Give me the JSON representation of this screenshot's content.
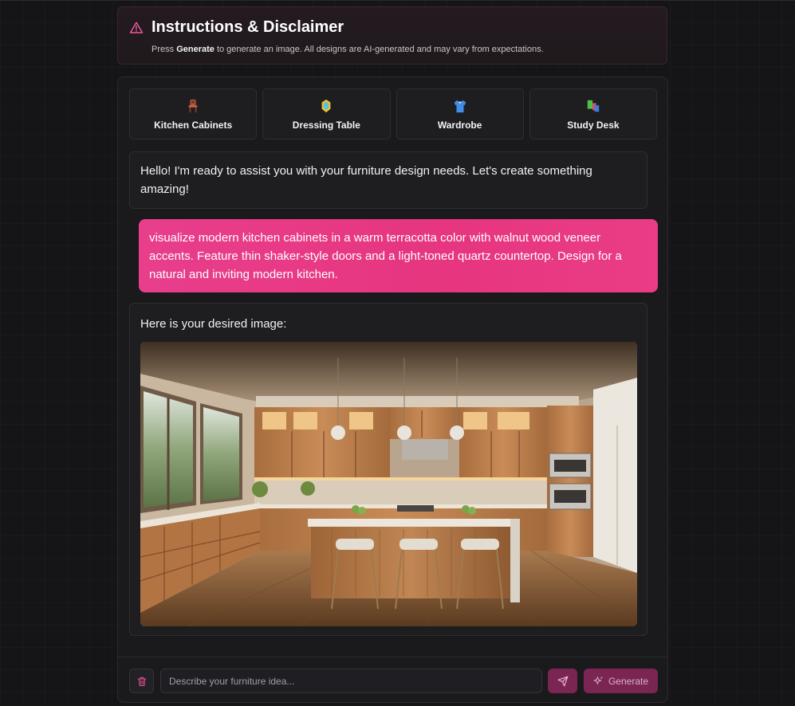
{
  "disclaimer": {
    "title": "Instructions & Disclaimer",
    "text_before": "Press ",
    "text_bold": "Generate",
    "text_after": " to generate an image. All designs are AI-generated and may vary from expectations.",
    "icon": "warning-triangle-icon"
  },
  "categories": [
    {
      "label": "Kitchen Cabinets",
      "icon": "chair-icon"
    },
    {
      "label": "Dressing Table",
      "icon": "mirror-icon"
    },
    {
      "label": "Wardrobe",
      "icon": "shirt-icon"
    },
    {
      "label": "Study Desk",
      "icon": "books-icon"
    }
  ],
  "messages": {
    "greeting": "Hello! I'm ready to assist you with your furniture design needs. Let's create something amazing!",
    "user_prompt": "visualize modern kitchen cabinets in a warm terracotta color with walnut wood veneer accents. Feature thin shaker-style doors and a light-toned quartz countertop. Design for a natural and inviting modern kitchen.",
    "result_caption": "Here is your desired image:"
  },
  "composer": {
    "placeholder": "Describe your furniture idea...",
    "generate_label": "Generate"
  },
  "colors": {
    "accent": "#e83e8c",
    "accent_muted": "#7b2553",
    "background": "#151416",
    "panel": "#1a1a1d"
  }
}
